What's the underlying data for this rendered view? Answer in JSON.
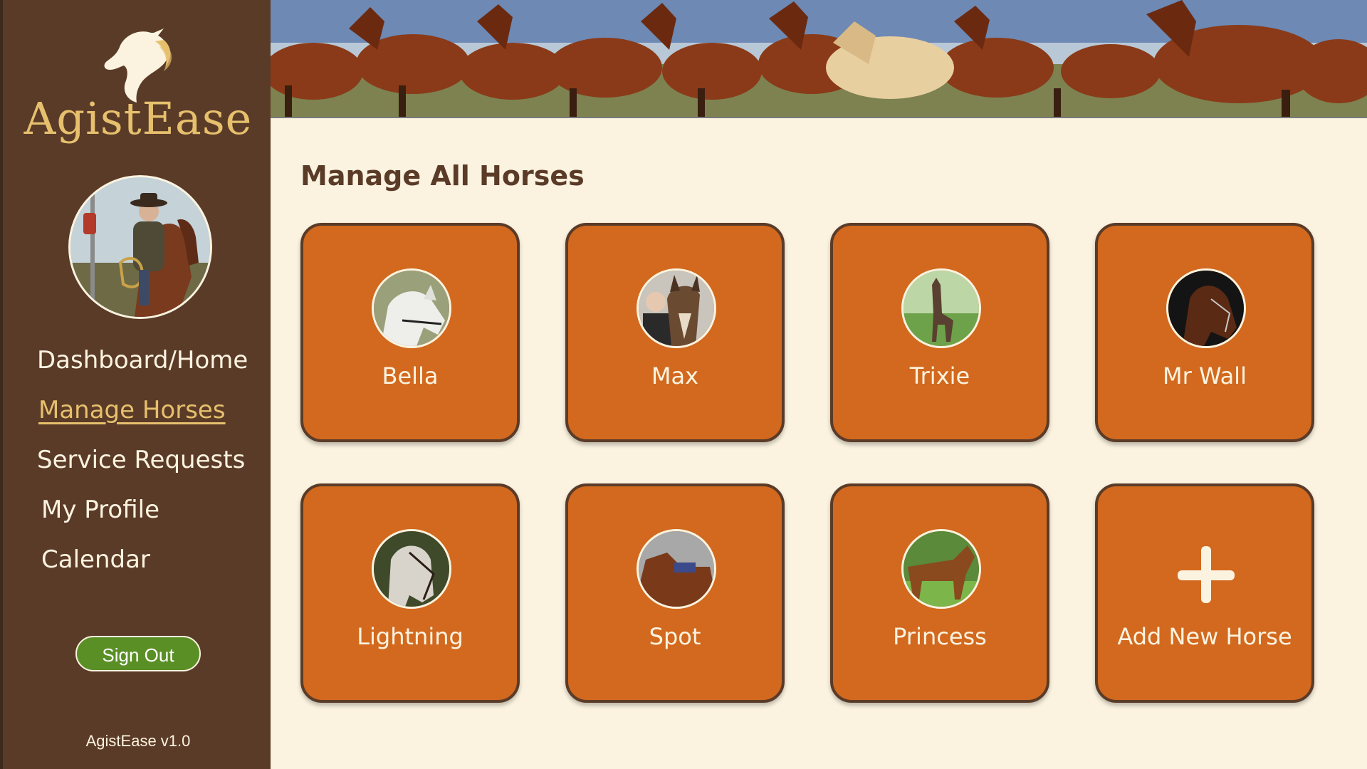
{
  "app": {
    "name": "AgistEase",
    "version": "AgistEase v1.0",
    "logo_icon": "horse-head-icon"
  },
  "sidebar": {
    "nav": [
      {
        "label": "Dashboard/Home",
        "active": false
      },
      {
        "label": "Manage Horses",
        "active": true
      },
      {
        "label": "Service Requests",
        "active": false
      },
      {
        "label": "My Profile",
        "active": false
      },
      {
        "label": "Calendar",
        "active": false
      }
    ],
    "sign_out_label": "Sign Out"
  },
  "main": {
    "title": "Manage All Horses",
    "horses": [
      {
        "name": "Bella"
      },
      {
        "name": "Max"
      },
      {
        "name": "Trixie"
      },
      {
        "name": "Mr Wall"
      },
      {
        "name": "Lightning"
      },
      {
        "name": "Spot"
      },
      {
        "name": "Princess"
      }
    ],
    "add_label": "Add New Horse"
  },
  "colors": {
    "sidebar_bg": "#5a3b28",
    "accent_gold": "#e6c06d",
    "card_orange": "#d2691e",
    "page_bg": "#fbf3e0",
    "signout_green": "#5a8f26"
  }
}
